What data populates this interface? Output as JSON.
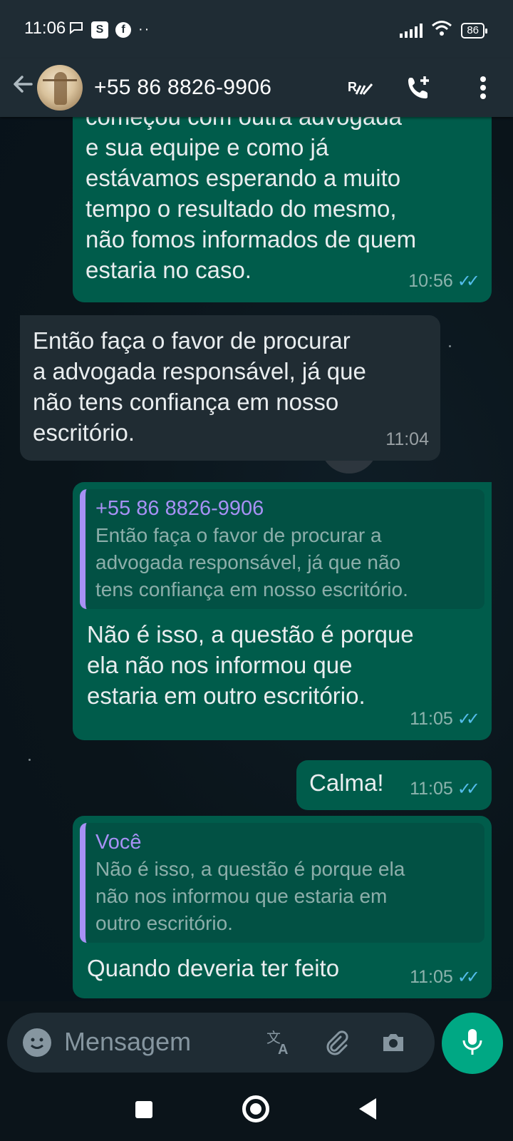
{
  "status_bar": {
    "time": "11:06",
    "battery": "86",
    "s_icon": "S",
    "fb_icon": "f",
    "dots": "··"
  },
  "header": {
    "contact_name": "+55 86 8826-9906",
    "icons": [
      "back-arrow-icon",
      "avatar",
      "ai-icon",
      "add-call-icon",
      "more-icon"
    ]
  },
  "messages": [
    {
      "direction": "out",
      "text_lines": [
        "começou com outra advogada",
        "e sua equipe e como já",
        "estávamos esperando a muito",
        "tempo o resultado do mesmo,",
        "não fomos informados de quem",
        "estaria no caso."
      ],
      "time": "10:56",
      "read": true
    },
    {
      "direction": "in",
      "text_lines": [
        "Então faça o favor de procurar",
        "a advogada responsável, já que",
        "não tens confiança em nosso",
        "escritório."
      ],
      "time": "11:04"
    },
    {
      "direction": "out",
      "quote_author": "+55 86 8826-9906",
      "quote_lines": [
        "Então faça o favor de procurar a",
        "advogada responsável, já que não",
        "tens confiança em nosso escritório."
      ],
      "text_lines": [
        "Não é isso, a questão é porque",
        "ela não nos informou que",
        "estaria em outro escritório."
      ],
      "time": "11:05",
      "read": true
    },
    {
      "direction": "out",
      "text_lines": [
        "Calma!"
      ],
      "time": "11:05",
      "read": true
    },
    {
      "direction": "out",
      "quote_author": "Você",
      "quote_lines": [
        "Não é isso, a questão é porque ela",
        "não nos informou que estaria em",
        "outro escritório."
      ],
      "text_lines": [
        "Quando deveria ter feito"
      ],
      "time": "11:05",
      "read": true
    }
  ],
  "input": {
    "placeholder": "Mensagem"
  },
  "colors": {
    "outgoing_bubble": "#005c4b",
    "incoming_bubble": "#202c33",
    "quote_accent": "#a791f5",
    "read_ticks": "#53bdeb",
    "mic_button": "#00a884",
    "header_bg": "#1f2c34"
  }
}
